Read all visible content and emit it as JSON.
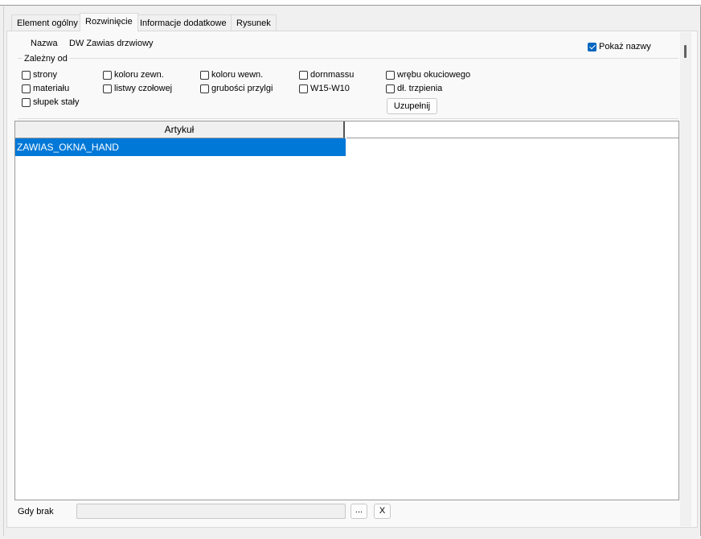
{
  "tabs": [
    {
      "label": "Element ogólny"
    },
    {
      "label": "Rozwinięcie"
    },
    {
      "label": "Informacje dodatkowe"
    },
    {
      "label": "Rysunek"
    }
  ],
  "name_row": {
    "label": "Nazwa",
    "value": "DW Zawias drzwiowy"
  },
  "show_names": {
    "label": "Pokaż nazwy",
    "checked": true
  },
  "depends": {
    "title": "Zależny od",
    "checkboxes": [
      {
        "label": "strony",
        "checked": false
      },
      {
        "label": "materiału",
        "checked": false
      },
      {
        "label": "słupek stały",
        "checked": false
      },
      {
        "label": "koloru zewn.",
        "checked": false
      },
      {
        "label": "listwy czołowej",
        "checked": false
      },
      {
        "label": "koloru wewn.",
        "checked": false
      },
      {
        "label": "grubości przylgi",
        "checked": false
      },
      {
        "label": "dornmassu",
        "checked": false
      },
      {
        "label": "W15-W10",
        "checked": false
      },
      {
        "label": "wrębu okuciowego",
        "checked": false
      },
      {
        "label": "dł. trzpienia",
        "checked": false
      }
    ],
    "fill_button": "Uzupełnij"
  },
  "grid": {
    "columns": [
      "Artykuł",
      ""
    ],
    "rows": [
      [
        "ZAWIAS_OKNA_HAND",
        ""
      ]
    ]
  },
  "footer": {
    "label": "Gdy brak",
    "value": "",
    "browse_button": "...",
    "clear_button": "X"
  }
}
